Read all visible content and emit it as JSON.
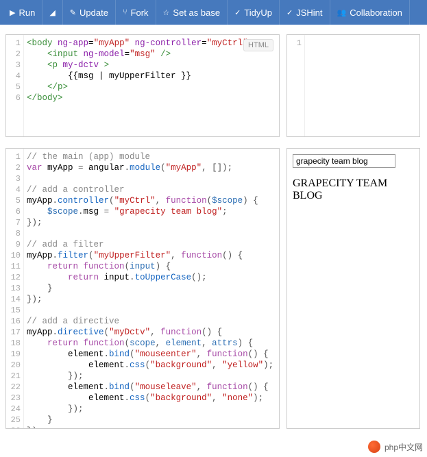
{
  "toolbar": {
    "run": "Run",
    "update": "Update",
    "fork": "Fork",
    "setAsBase": "Set as base",
    "tidyUp": "TidyUp",
    "jshint": "JSHint",
    "collaboration": "Collaboration"
  },
  "htmlPanel": {
    "badge": "HTML",
    "lines": [
      [
        {
          "t": "tag",
          "v": "<body"
        },
        {
          "t": "txt",
          "v": " "
        },
        {
          "t": "attr",
          "v": "ng-app"
        },
        {
          "t": "txt",
          "v": "="
        },
        {
          "t": "str",
          "v": "\"myApp\""
        },
        {
          "t": "txt",
          "v": " "
        },
        {
          "t": "attr",
          "v": "ng-controller"
        },
        {
          "t": "txt",
          "v": "="
        },
        {
          "t": "str",
          "v": "\"myCtrl\""
        },
        {
          "t": "tag",
          "v": ">"
        }
      ],
      [
        {
          "t": "txt",
          "v": "    "
        },
        {
          "t": "tag",
          "v": "<input"
        },
        {
          "t": "txt",
          "v": " "
        },
        {
          "t": "attr",
          "v": "ng-model"
        },
        {
          "t": "txt",
          "v": "="
        },
        {
          "t": "str",
          "v": "\"msg\""
        },
        {
          "t": "txt",
          "v": " "
        },
        {
          "t": "tag",
          "v": "/>"
        }
      ],
      [
        {
          "t": "txt",
          "v": "    "
        },
        {
          "t": "tag",
          "v": "<p"
        },
        {
          "t": "txt",
          "v": " "
        },
        {
          "t": "attr",
          "v": "my-dctv"
        },
        {
          "t": "txt",
          "v": " "
        },
        {
          "t": "tag",
          "v": ">"
        }
      ],
      [
        {
          "t": "txt",
          "v": "        {{msg | myUpperFilter }}"
        }
      ],
      [
        {
          "t": "txt",
          "v": "    "
        },
        {
          "t": "tag",
          "v": "</p>"
        }
      ],
      [
        {
          "t": "tag",
          "v": "</body>"
        }
      ]
    ]
  },
  "jsPanel": {
    "lines": [
      [
        {
          "t": "cmt",
          "v": "// the main (app) module"
        }
      ],
      [
        {
          "t": "kw",
          "v": "var"
        },
        {
          "t": "txt",
          "v": " myApp "
        },
        {
          "t": "punc",
          "v": "="
        },
        {
          "t": "txt",
          "v": " angular"
        },
        {
          "t": "punc",
          "v": "."
        },
        {
          "t": "fn",
          "v": "module"
        },
        {
          "t": "punc",
          "v": "("
        },
        {
          "t": "str",
          "v": "\"myApp\""
        },
        {
          "t": "punc",
          "v": ", []);"
        }
      ],
      [],
      [
        {
          "t": "cmt",
          "v": "// add a controller"
        }
      ],
      [
        {
          "t": "txt",
          "v": "myApp"
        },
        {
          "t": "punc",
          "v": "."
        },
        {
          "t": "fn",
          "v": "controller"
        },
        {
          "t": "punc",
          "v": "("
        },
        {
          "t": "str",
          "v": "\"myCtrl\""
        },
        {
          "t": "punc",
          "v": ", "
        },
        {
          "t": "kw",
          "v": "function"
        },
        {
          "t": "punc",
          "v": "("
        },
        {
          "t": "var",
          "v": "$scope"
        },
        {
          "t": "punc",
          "v": ") {"
        }
      ],
      [
        {
          "t": "txt",
          "v": "    "
        },
        {
          "t": "var",
          "v": "$scope"
        },
        {
          "t": "punc",
          "v": "."
        },
        {
          "t": "txt",
          "v": "msg "
        },
        {
          "t": "punc",
          "v": "="
        },
        {
          "t": "txt",
          "v": " "
        },
        {
          "t": "str",
          "v": "\"grapecity team blog\""
        },
        {
          "t": "punc",
          "v": ";"
        }
      ],
      [
        {
          "t": "punc",
          "v": "});"
        }
      ],
      [],
      [
        {
          "t": "cmt",
          "v": "// add a filter"
        }
      ],
      [
        {
          "t": "txt",
          "v": "myApp"
        },
        {
          "t": "punc",
          "v": "."
        },
        {
          "t": "fn",
          "v": "filter"
        },
        {
          "t": "punc",
          "v": "("
        },
        {
          "t": "str",
          "v": "\"myUpperFilter\""
        },
        {
          "t": "punc",
          "v": ", "
        },
        {
          "t": "kw",
          "v": "function"
        },
        {
          "t": "punc",
          "v": "() {"
        }
      ],
      [
        {
          "t": "txt",
          "v": "    "
        },
        {
          "t": "kw",
          "v": "return"
        },
        {
          "t": "txt",
          "v": " "
        },
        {
          "t": "kw",
          "v": "function"
        },
        {
          "t": "punc",
          "v": "("
        },
        {
          "t": "var",
          "v": "input"
        },
        {
          "t": "punc",
          "v": ") {"
        }
      ],
      [
        {
          "t": "txt",
          "v": "        "
        },
        {
          "t": "kw",
          "v": "return"
        },
        {
          "t": "txt",
          "v": " input"
        },
        {
          "t": "punc",
          "v": "."
        },
        {
          "t": "fn",
          "v": "toUpperCase"
        },
        {
          "t": "punc",
          "v": "();"
        }
      ],
      [
        {
          "t": "txt",
          "v": "    "
        },
        {
          "t": "punc",
          "v": "}"
        }
      ],
      [
        {
          "t": "punc",
          "v": "});"
        }
      ],
      [],
      [
        {
          "t": "cmt",
          "v": "// add a directive"
        }
      ],
      [
        {
          "t": "txt",
          "v": "myApp"
        },
        {
          "t": "punc",
          "v": "."
        },
        {
          "t": "fn",
          "v": "directive"
        },
        {
          "t": "punc",
          "v": "("
        },
        {
          "t": "str",
          "v": "\"myDctv\""
        },
        {
          "t": "punc",
          "v": ", "
        },
        {
          "t": "kw",
          "v": "function"
        },
        {
          "t": "punc",
          "v": "() {"
        }
      ],
      [
        {
          "t": "txt",
          "v": "    "
        },
        {
          "t": "kw",
          "v": "return"
        },
        {
          "t": "txt",
          "v": " "
        },
        {
          "t": "kw",
          "v": "function"
        },
        {
          "t": "punc",
          "v": "("
        },
        {
          "t": "var",
          "v": "scope"
        },
        {
          "t": "punc",
          "v": ", "
        },
        {
          "t": "var",
          "v": "element"
        },
        {
          "t": "punc",
          "v": ", "
        },
        {
          "t": "var",
          "v": "attrs"
        },
        {
          "t": "punc",
          "v": ") {"
        }
      ],
      [
        {
          "t": "txt",
          "v": "        element"
        },
        {
          "t": "punc",
          "v": "."
        },
        {
          "t": "fn",
          "v": "bind"
        },
        {
          "t": "punc",
          "v": "("
        },
        {
          "t": "str",
          "v": "\"mouseenter\""
        },
        {
          "t": "punc",
          "v": ", "
        },
        {
          "t": "kw",
          "v": "function"
        },
        {
          "t": "punc",
          "v": "() {"
        }
      ],
      [
        {
          "t": "txt",
          "v": "            element"
        },
        {
          "t": "punc",
          "v": "."
        },
        {
          "t": "fn",
          "v": "css"
        },
        {
          "t": "punc",
          "v": "("
        },
        {
          "t": "str",
          "v": "\"background\""
        },
        {
          "t": "punc",
          "v": ", "
        },
        {
          "t": "str",
          "v": "\"yellow\""
        },
        {
          "t": "punc",
          "v": ");"
        }
      ],
      [
        {
          "t": "txt",
          "v": "        "
        },
        {
          "t": "punc",
          "v": "});"
        }
      ],
      [
        {
          "t": "txt",
          "v": "        element"
        },
        {
          "t": "punc",
          "v": "."
        },
        {
          "t": "fn",
          "v": "bind"
        },
        {
          "t": "punc",
          "v": "("
        },
        {
          "t": "str",
          "v": "\"mouseleave\""
        },
        {
          "t": "punc",
          "v": ", "
        },
        {
          "t": "kw",
          "v": "function"
        },
        {
          "t": "punc",
          "v": "() {"
        }
      ],
      [
        {
          "t": "txt",
          "v": "            element"
        },
        {
          "t": "punc",
          "v": "."
        },
        {
          "t": "fn",
          "v": "css"
        },
        {
          "t": "punc",
          "v": "("
        },
        {
          "t": "str",
          "v": "\"background\""
        },
        {
          "t": "punc",
          "v": ", "
        },
        {
          "t": "str",
          "v": "\"none\""
        },
        {
          "t": "punc",
          "v": ");"
        }
      ],
      [
        {
          "t": "txt",
          "v": "        "
        },
        {
          "t": "punc",
          "v": "});"
        }
      ],
      [
        {
          "t": "txt",
          "v": "    "
        },
        {
          "t": "punc",
          "v": "}"
        }
      ],
      [
        {
          "t": "punc",
          "v": "});"
        }
      ]
    ]
  },
  "topRightPanel": {
    "lineNumbers": [
      "1"
    ]
  },
  "result": {
    "inputValue": "grapecity team blog",
    "outputText": "GRAPECITY TEAM BLOG"
  },
  "watermark": "php中文网"
}
